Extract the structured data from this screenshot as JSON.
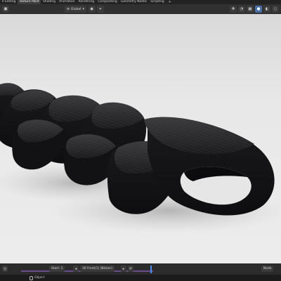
{
  "topbar": {
    "tabs": [
      "V Editing",
      "Texture Paint",
      "Shading",
      "Animation",
      "Rendering",
      "Compositing",
      "Geometry Nodes",
      "Scripting"
    ],
    "active_tab": 1,
    "add_tab": "+"
  },
  "header": {
    "editor_icon": "cube-icon",
    "mode_label": "Global",
    "mode_chevron": "▾",
    "snap_icon": "magnet-icon",
    "proportional_icon": "circle-icon",
    "gizmo_icon": "arrows-icon",
    "overlay_icon": "overlay-icon",
    "xray_icon": "xray-icon",
    "shading_solid_icon": "solid-sphere-icon",
    "shading_material_icon": "material-sphere-icon",
    "shading_rendered_icon": "rendered-sphere-icon"
  },
  "timeline": {
    "range_label": "Start: 1",
    "view_label": "30 Front(1) (Bézier)",
    "playhead_frame": 200,
    "keying_label": "Node"
  },
  "status": {
    "object_label": "Object"
  },
  "colors": {
    "viewport_bg": "#e9e9e9",
    "object_color": "#1f1f21",
    "accent": "#4a6fa5",
    "keyframe_track": "#6a4b8c",
    "playhead": "#4a8df0"
  }
}
